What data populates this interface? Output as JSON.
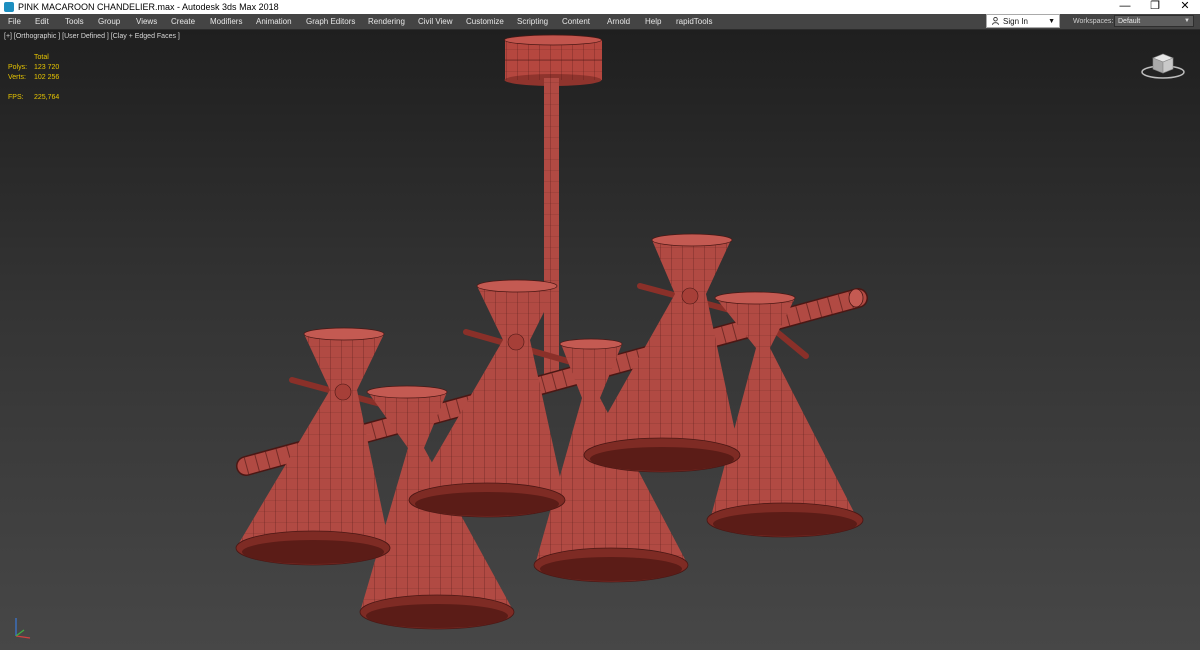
{
  "window": {
    "title": "PINK MACAROON CHANDELIER.max - Autodesk 3ds Max 2018",
    "controls": [
      "minimize-icon",
      "restore-icon",
      "close-icon"
    ]
  },
  "menu": {
    "items": [
      "File",
      "Edit",
      "Tools",
      "Group",
      "Views",
      "Create",
      "Modifiers",
      "Animation",
      "Graph Editors",
      "Rendering",
      "Civil View",
      "Customize",
      "Scripting",
      "Content",
      "Arnold",
      "Help",
      "rapidTools"
    ]
  },
  "account": {
    "sign_in": "Sign In",
    "icon": "user-icon"
  },
  "workspaces": {
    "label": "Workspaces:",
    "value": "Default"
  },
  "viewport": {
    "label": "[+] [Orthographic ] [User Defined ] [Clay + Edged Faces ]",
    "stats": {
      "header": "Total",
      "polys_label": "Polys:",
      "polys": "123 720",
      "verts_label": "Verts:",
      "verts": "102 256",
      "fps_label": "FPS:",
      "fps": "225,764"
    },
    "viewcube_icon": "viewcube-icon",
    "axis_icon": "axis-tripod-icon",
    "model_color": "#b14a43",
    "stat_color": "#e8c600"
  }
}
